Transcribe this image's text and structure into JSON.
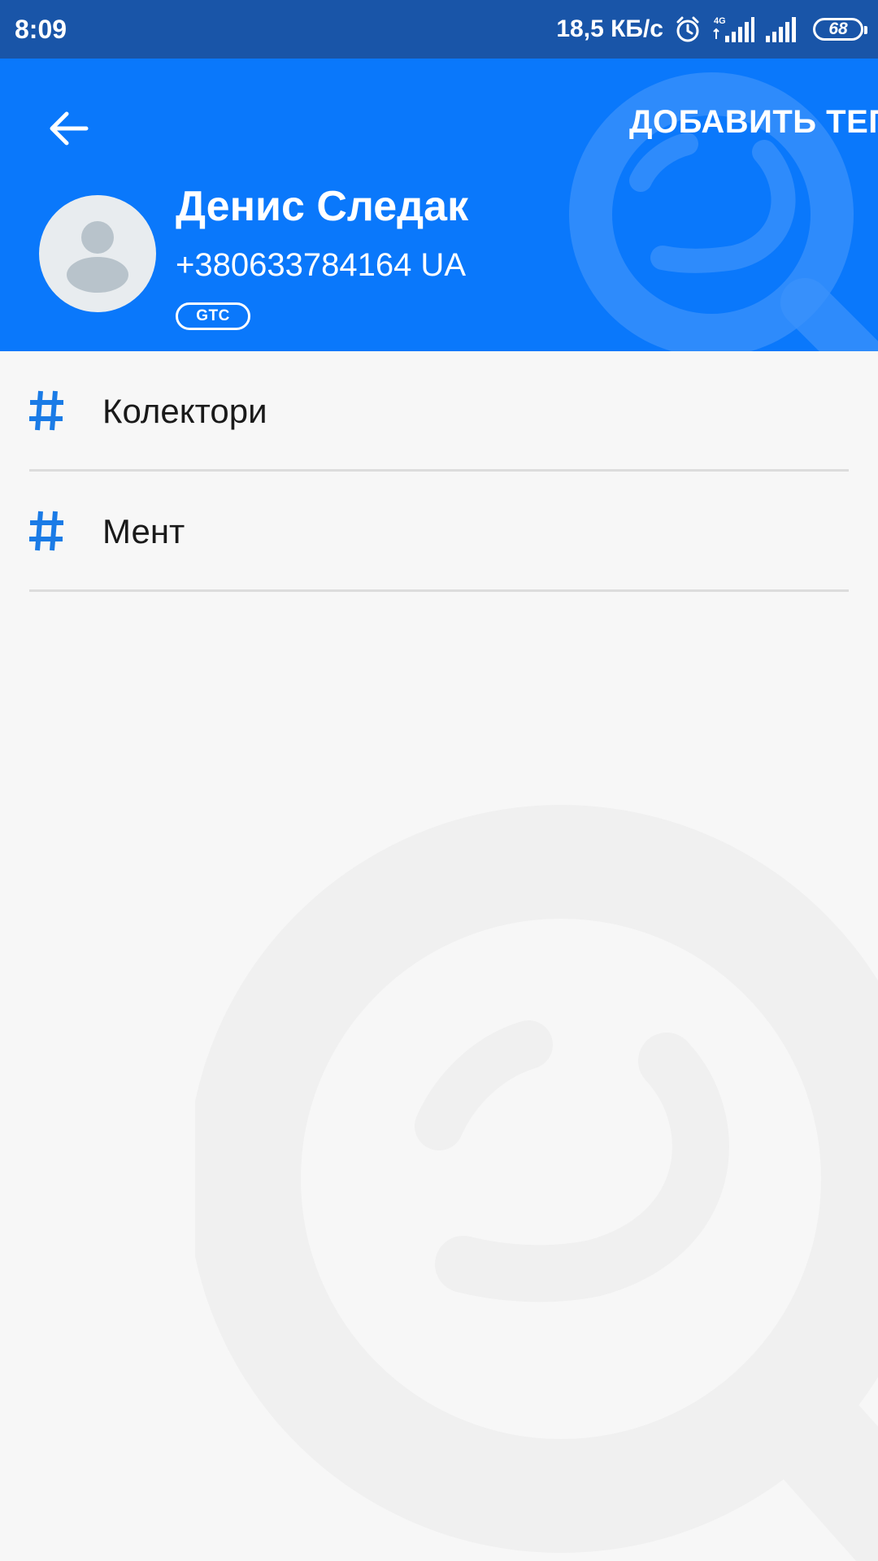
{
  "status_bar": {
    "time": "8:09",
    "network_speed": "18,5 КБ/с",
    "network_type": "4G",
    "battery": "68",
    "icons": [
      "alarm-icon",
      "signal-icon",
      "signal-icon",
      "battery-icon"
    ]
  },
  "header": {
    "back_icon": "arrow-back-icon",
    "add_tag_label": "ДОБАВИТЬ ТЕГ",
    "contact_name": "Денис Следак",
    "phone": "+380633784164 UA",
    "operator_badge": "GTC",
    "background_color": "#0a78fb"
  },
  "tags": [
    {
      "icon": "hashtag-icon",
      "label": "Колектори"
    },
    {
      "icon": "hashtag-icon",
      "label": "Мент"
    }
  ],
  "colors": {
    "status_bar": "#1955a8",
    "accent": "#0a78fb",
    "hash_icon": "#1a7be6",
    "background": "#f7f7f7"
  }
}
